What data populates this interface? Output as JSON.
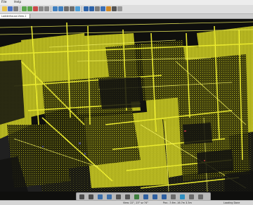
{
  "menu": {
    "items": [
      "File",
      "Help"
    ]
  },
  "tab": {
    "active_label": "Ladderhouse-View-1"
  },
  "status": {
    "view": "View: 22°, 23° sz 74°",
    "pos": "Pos: -7.6m -16.7m 3.3m",
    "loading": "Loading Done"
  },
  "colors": {
    "point_cloud": "#d7d71c",
    "background": "#0f0f0d"
  },
  "icons": {
    "toolbar": [
      "open-icon",
      "save-icon",
      "print-icon",
      "undo-icon",
      "redo-icon",
      "cut-icon",
      "copy-icon",
      "paste-icon",
      "select-icon",
      "measure-icon",
      "zoom-icon",
      "pan-icon",
      "rotate-icon",
      "clip-icon",
      "layers-icon",
      "settings-icon",
      "help-icon",
      "color-icon",
      "pen-icon",
      "grid-icon"
    ],
    "navbar": [
      "orbit-icon",
      "pan-icon",
      "zoom-in-icon",
      "zoom-out-icon",
      "walk-icon",
      "fly-icon",
      "fit-icon",
      "front-view-icon",
      "top-view-icon",
      "side-view-icon",
      "perspective-icon",
      "measure-icon",
      "reset-view-icon",
      "settings-icon"
    ]
  }
}
